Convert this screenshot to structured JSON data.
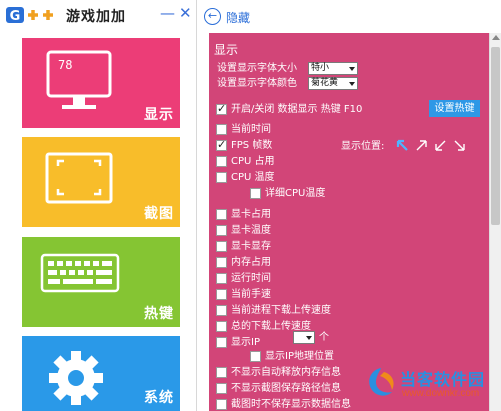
{
  "app": {
    "title": "游戏加加",
    "minimize": "—",
    "close": "✕",
    "logo_text": "G++"
  },
  "tiles": [
    {
      "label": "显示",
      "fps_value": "78",
      "color": "#ec3d77"
    },
    {
      "label": "截图",
      "color": "#f8bd2a"
    },
    {
      "label": "热键",
      "color": "#85c533"
    },
    {
      "label": "系统",
      "color": "#2a99e8"
    }
  ],
  "topbar": {
    "back_icon": "←",
    "hide_label": "隐藏"
  },
  "panel": {
    "section_title": "显示",
    "font_size_label": "设置显示字体大小",
    "font_size_value": "特小",
    "font_color_label": "设置显示字体颜色",
    "font_color_value": "菊花黄",
    "toggle_label": "开启/关闭 数据显示 热键 F10",
    "hotkey_button": "设置热键",
    "position_label": "显示位置:",
    "ip_count_suffix": "个",
    "options": [
      {
        "label": "当前时间",
        "checked": false
      },
      {
        "label": "FPS 帧数",
        "checked": true
      },
      {
        "label": "CPU 占用",
        "checked": false
      },
      {
        "label": "CPU 温度",
        "checked": false
      },
      {
        "label": "详细CPU温度",
        "checked": false
      },
      {
        "label": "显卡占用",
        "checked": false
      },
      {
        "label": "显卡温度",
        "checked": false
      },
      {
        "label": "显卡显存",
        "checked": false
      },
      {
        "label": "内存占用",
        "checked": false
      },
      {
        "label": "运行时间",
        "checked": false
      },
      {
        "label": "当前手速",
        "checked": false
      },
      {
        "label": "当前进程下载上传速度",
        "checked": false
      },
      {
        "label": "总的下载上传速度",
        "checked": false
      },
      {
        "label": "显示IP",
        "checked": false
      },
      {
        "label": "显示IP地理位置",
        "checked": false
      },
      {
        "label": "不显示自动释放内存信息",
        "checked": false
      },
      {
        "label": "不显示截图保存路径信息",
        "checked": false
      },
      {
        "label": "截图时不保存显示数据信息",
        "checked": false
      }
    ],
    "accent_color": "#d24578"
  },
  "watermark": {
    "title": "当客软件园",
    "url": "www.downkr.com"
  }
}
